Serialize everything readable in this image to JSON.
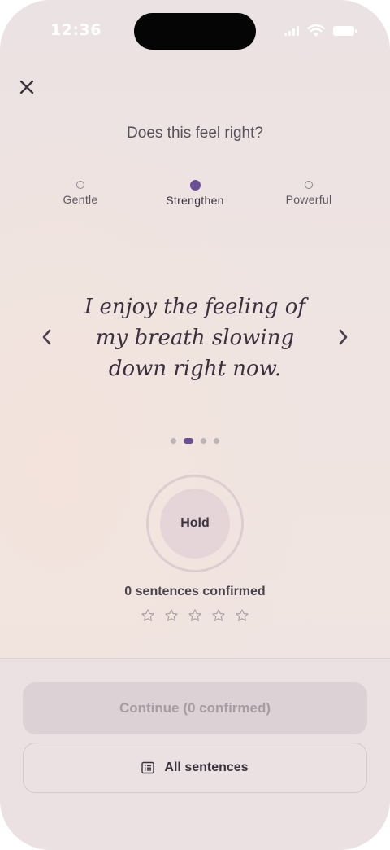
{
  "status_bar": {
    "time": "12:36"
  },
  "header": {
    "question": "Does this feel right?"
  },
  "intensity": {
    "options": [
      {
        "label": "Gentle",
        "selected": false
      },
      {
        "label": "Strengthen",
        "selected": true
      },
      {
        "label": "Powerful",
        "selected": false
      }
    ]
  },
  "sentence": {
    "text": "I enjoy the feeling of my breath slowing down right now."
  },
  "pager": {
    "count": 4,
    "active_index": 1
  },
  "hold": {
    "label": "Hold"
  },
  "progress": {
    "confirmed_text": "0 sentences confirmed",
    "stars_total": 5,
    "stars_filled": 0
  },
  "footer": {
    "continue_label": "Continue (0 confirmed)",
    "all_sentences_label": "All sentences"
  },
  "colors": {
    "accent": "#6b4f95",
    "text_dark": "#3c2f3f",
    "disabled_text": "#a89ca3"
  },
  "icons": {
    "close": "close-icon",
    "prev": "chevron-left-icon",
    "next": "chevron-right-icon",
    "list": "list-icon",
    "star": "star-outline-icon"
  }
}
